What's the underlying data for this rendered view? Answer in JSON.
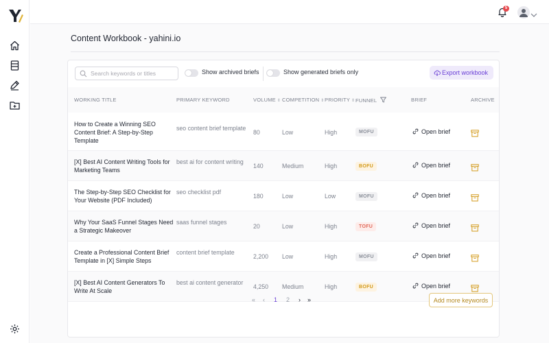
{
  "colors": {
    "accent": "#6a3fd6",
    "logo": "#e0b43a",
    "badge": "#e5484d",
    "archive": "#d39a1a",
    "add_more": "#b4881f"
  },
  "sidebar": {
    "icons": [
      "home-icon",
      "book-icon",
      "pen-icon",
      "folder-add-icon"
    ],
    "footer_icon": "settings-icon"
  },
  "topbar": {
    "notification_count": "5"
  },
  "page": {
    "title": "Content Workbook - yahini.io"
  },
  "toolbar": {
    "search_placeholder": "Search keywords or titles",
    "show_archived_label": "Show archived briefs",
    "show_generated_label": "Show generated briefs only",
    "export_label": "Export workbook"
  },
  "table": {
    "headers": {
      "title": "WORKING TITLE",
      "keyword": "PRIMARY KEYWORD",
      "volume": "VOLUME",
      "competition": "COMPETITION",
      "priority": "PRIORITY",
      "funnel": "FUNNEL",
      "brief": "BRIEF",
      "archive": "ARCHIVE"
    },
    "rows": [
      {
        "title": "How to Create a Winning SEO Content Brief: A Step-by-Step Template",
        "keyword": "seo content brief template",
        "volume": "80",
        "competition": "Low",
        "priority": "High",
        "funnel": "MOFU",
        "brief": "Open brief"
      },
      {
        "title": "[X] Best AI Content Writing Tools for Marketing Teams",
        "keyword": "best ai for content writing",
        "volume": "140",
        "competition": "Medium",
        "priority": "High",
        "funnel": "BOFU",
        "brief": "Open brief"
      },
      {
        "title": "The Step-by-Step SEO Checklist for Your Website (PDF Included)",
        "keyword": "seo checklist pdf",
        "volume": "180",
        "competition": "Low",
        "priority": "Low",
        "funnel": "MOFU",
        "brief": "Open brief"
      },
      {
        "title": "Why Your SaaS Funnel Stages Need a Strategic Makeover",
        "keyword": "saas funnel stages",
        "volume": "20",
        "competition": "Low",
        "priority": "High",
        "funnel": "TOFU",
        "brief": "Open brief"
      },
      {
        "title": "Create a Professional Content Brief Template in [X] Simple Steps",
        "keyword": "content brief template",
        "volume": "2,200",
        "competition": "Low",
        "priority": "High",
        "funnel": "MOFU",
        "brief": "Open brief"
      },
      {
        "title": "[X] Best AI Content Generators To Write At Scale",
        "keyword": "best ai content generator",
        "volume": "4,250",
        "competition": "Medium",
        "priority": "High",
        "funnel": "BOFU",
        "brief": "Open brief"
      }
    ]
  },
  "funnel_colors": {
    "MOFU": {
      "bg": "#f1f1f3",
      "fg": "#8a8f99"
    },
    "BOFU": {
      "bg": "#fdf3e1",
      "fg": "#d39a1a"
    },
    "TOFU": {
      "bg": "#fdecea",
      "fg": "#e06a5a"
    }
  },
  "pagination": {
    "first": "«",
    "prev": "‹",
    "pages": [
      "1",
      "2"
    ],
    "current": "1",
    "next": "›",
    "last": "»"
  },
  "footer": {
    "add_more_label": "Add more keywords"
  }
}
